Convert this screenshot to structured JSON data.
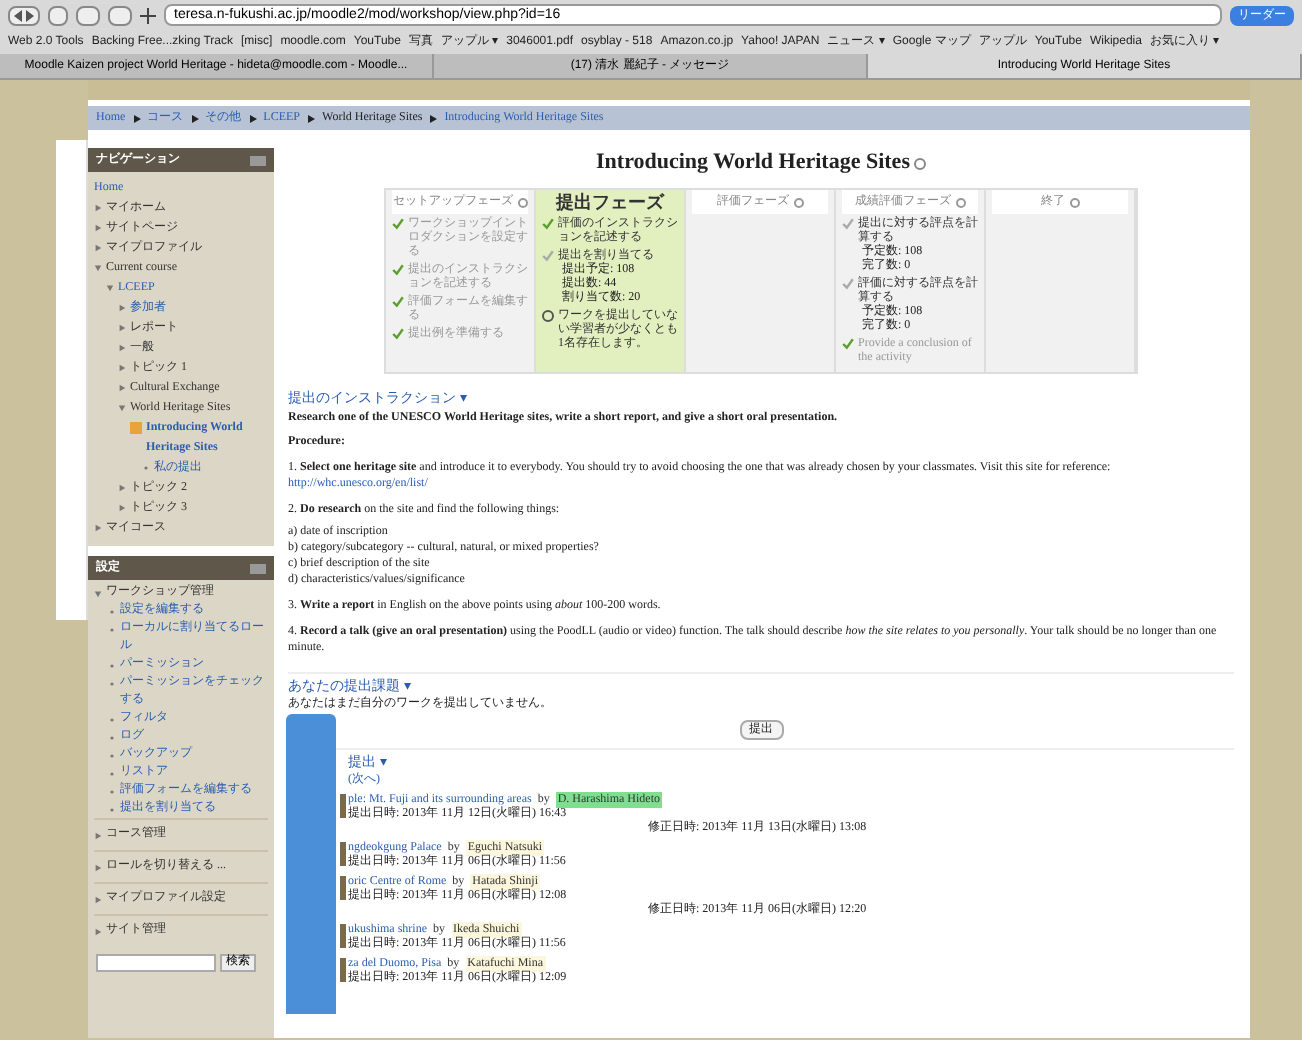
{
  "browser": {
    "address": "teresa.n-fukushi.ac.jp/moodle2/mod/workshop/view.php?id=16",
    "reader_button": "リーダー",
    "bookmarks": [
      "Web 2.0 Tools",
      "Backing Free...zking Track",
      "[misc]",
      "moodle.com",
      "YouTube",
      "写真",
      "アップル ▾",
      "3046001.pdf",
      "osyblay - 518",
      "Amazon.co.jp",
      "Yahoo! JAPAN",
      "ニュース ▾",
      "Google マップ",
      "アップル",
      "YouTube",
      "Wikipedia",
      "お気に入り ▾"
    ],
    "tabs": [
      {
        "label": "Moodle Kaizen project World Heritage - hideta@moodle.com - Moodle...",
        "selected": false
      },
      {
        "label": "(17) 清水 麗紀子 - メッセージ",
        "selected": false
      },
      {
        "label": "Introducing World Heritage Sites",
        "selected": true
      }
    ]
  },
  "breadcrumb": [
    {
      "label": "Home",
      "link": true
    },
    {
      "label": "コース",
      "link": true
    },
    {
      "label": "その他",
      "link": true
    },
    {
      "label": "LCEEP",
      "link": true
    },
    {
      "label": "World Heritage Sites",
      "link": false
    },
    {
      "label": "Introducing World Heritage Sites",
      "link": true
    }
  ],
  "navigation": {
    "title": "ナビゲーション",
    "items": [
      {
        "label": "Home",
        "link": true,
        "current": false
      },
      {
        "label": "マイホーム",
        "link": false,
        "current": false,
        "expanded": false
      },
      {
        "label": "サイトページ",
        "link": false,
        "current": false,
        "expanded": false
      },
      {
        "label": "マイプロファイル",
        "link": false,
        "current": false,
        "expanded": false
      },
      {
        "label": "Current course",
        "link": false,
        "current": false,
        "expanded": true,
        "children": [
          {
            "label": "LCEEP",
            "link": true,
            "current": false,
            "expanded": true,
            "children": [
              {
                "label": "参加者",
                "link": true,
                "current": false,
                "expanded": false
              },
              {
                "label": "レポート",
                "link": false,
                "current": false,
                "expanded": false
              },
              {
                "label": "一般",
                "link": false,
                "current": false,
                "expanded": false
              },
              {
                "label": "トピック 1",
                "link": false,
                "current": false,
                "expanded": false
              },
              {
                "label": "Cultural Exchange",
                "link": false,
                "current": false,
                "expanded": false
              },
              {
                "label": "World Heritage Sites",
                "link": false,
                "current": false,
                "expanded": true,
                "children": [
                  {
                    "label": "Introducing World Heritage Sites",
                    "link": true,
                    "current": true,
                    "children": [
                      {
                        "label": "私の提出",
                        "link": true,
                        "current": false
                      }
                    ]
                  }
                ]
              },
              {
                "label": "トピック 2",
                "link": false,
                "current": false,
                "expanded": false
              },
              {
                "label": "トピック 3",
                "link": false,
                "current": false,
                "expanded": false
              }
            ]
          }
        ]
      },
      {
        "label": "マイコース",
        "link": false,
        "current": false,
        "expanded": false
      }
    ]
  },
  "settings": {
    "title": "設定",
    "sections": [
      {
        "label": "ワークショップ管理",
        "expanded": true,
        "items": [
          "設定を編集する",
          "ローカルに割り当てるロール",
          "パーミッション",
          "パーミッションをチェックする",
          "フィルタ",
          "ログ",
          "バックアップ",
          "リストア",
          "評価フォームを編集する",
          "提出を割り当てる"
        ]
      },
      {
        "label": "コース管理",
        "expanded": false
      },
      {
        "label": "ロールを切り替える ...",
        "expanded": false
      },
      {
        "label": "マイプロファイル設定",
        "expanded": false
      },
      {
        "label": "サイト管理",
        "expanded": false
      }
    ],
    "search_button": "検索"
  },
  "title": "Introducing World Heritage Sites",
  "phases": [
    {
      "name": "セットアップフェーズ",
      "selected": false,
      "tasks": [
        {
          "text": "ワークショップイントロダクションを設定する",
          "done": true
        },
        {
          "text": "提出のインストラクションを記述する",
          "done": true
        },
        {
          "text": "評価フォームを編集する",
          "done": true
        },
        {
          "text": "提出例を準備する",
          "done": true
        }
      ]
    },
    {
      "name": "提出フェーズ",
      "selected": true,
      "tasks": [
        {
          "text": "評価のインストラクションを記述する",
          "done": true
        },
        {
          "text": "提出を割り当てる",
          "done": false,
          "details": [
            "提出予定: 108",
            "提出数: 44",
            "割り当て数: 20"
          ]
        },
        {
          "text": "ワークを提出していない学習者が少なくとも1名存在します。",
          "kind": "info"
        }
      ]
    },
    {
      "name": "評価フェーズ",
      "selected": false
    },
    {
      "name": "成績評価フェーズ",
      "selected": false,
      "tasks": [
        {
          "text": "提出に対する評点を計算する",
          "done": false,
          "details": [
            "予定数: 108",
            "完了数: 0"
          ]
        },
        {
          "text": "評価に対する評点を計算する",
          "done": false,
          "details": [
            "予定数: 108",
            "完了数: 0"
          ]
        },
        {
          "text": "Provide a conclusion of the activity",
          "done": true
        }
      ]
    },
    {
      "name": "終了",
      "selected": false
    }
  ],
  "instructions": {
    "heading": "提出のインストラクション ▾",
    "intro": "Research one of the UNESCO World Heritage sites, write a short report, and give a short oral presentation.",
    "procedure": "Procedure:",
    "steps": [
      {
        "text": "1. **Select one heritage site** and introduce it to everybody. You should try to avoid choosing the one that was already chosen by your classmates.  Visit this site for reference:",
        "link": "http://whc.unesco.org/en/list/"
      },
      {
        "text": "2. **Do research** on the site and find the following things:",
        "list": [
          "a) date of inscription",
          "b) category/subcategory -- cultural, natural, or mixed properties?",
          "c) brief description of the site",
          "d) characteristics/values/significance"
        ]
      },
      {
        "text": "3. **Write a report** in English on the above points using *about* 100-200 words."
      },
      {
        "text": "4. **Record a talk (give an oral presentation)** using the PoodLL (audio or video) function. The talk should describe *how the site relates to you personally*. Your talk should be no longer than one minute."
      }
    ]
  },
  "your_submission": {
    "heading": "あなたの提出課題 ▾",
    "message": "あなたはまだ自分のワークを提出していません。",
    "button": "提出"
  },
  "submissions": {
    "heading": "提出 ▾",
    "pager": "(次へ)",
    "items": [
      {
        "title": "ple: Mt. Fuji and its surrounding areas",
        "by": "by",
        "author": "D. Harashima Hideto",
        "color": "#7ee08f",
        "date": "提出日時: 2013年 11月 12日(火曜日) 16:43",
        "modified": "修正日時: 2013年 11月 13日(水曜日) 13:08"
      },
      {
        "title": "ngdeokgung Palace",
        "by": "by",
        "author": "Eguchi Natsuki",
        "color": "#fbf6dc",
        "date": "提出日時: 2013年 11月 06日(水曜日) 11:56"
      },
      {
        "title": "oric Centre of Rome",
        "by": "by",
        "author": "Hatada Shinji",
        "color": "#fbf6dc",
        "date": "提出日時: 2013年 11月 06日(水曜日) 12:08",
        "modified": "修正日時: 2013年 11月 06日(水曜日) 12:20"
      },
      {
        "title": "ukushima shrine",
        "by": "by",
        "author": "Ikeda Shuichi",
        "color": "#fbf6dc",
        "date": "提出日時: 2013年 11月 06日(水曜日) 11:56"
      },
      {
        "title": "za del Duomo, Pisa",
        "by": "by",
        "author": "Katafuchi Mina",
        "color": "#fbf6dc",
        "date": "提出日時: 2013年 11月 06日(水曜日) 12:09"
      }
    ]
  }
}
